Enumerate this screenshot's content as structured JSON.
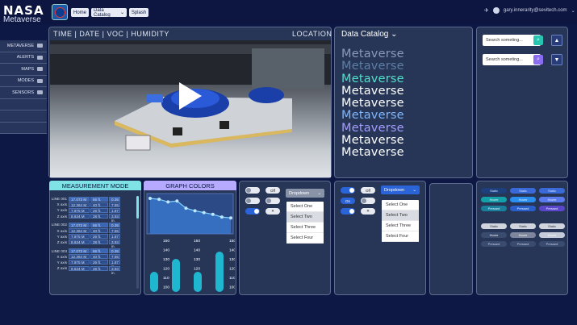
{
  "header": {
    "logo": "NASA",
    "app": "Metaverse",
    "nav": [
      "Home",
      "Data Catalog",
      "Splash"
    ],
    "user_email": "gary.innerarity@sevitech.com"
  },
  "sidebar": {
    "items": [
      "METAVERSE",
      "ALERTS",
      "MAPS",
      "MODES",
      "SENSORS",
      "",
      "",
      ""
    ]
  },
  "video": {
    "labels": "TIME  |  DATE  |  VOC  |  HUMIDITY",
    "location": "LOCATION"
  },
  "catalog": {
    "title": "Data Catalog",
    "items": [
      "Metaverse",
      "Metaverse",
      "Metaverse",
      "Metaverse",
      "Metaverse",
      "Metaverse",
      "Metaverse",
      "Metaverse",
      "Metaverse"
    ],
    "colors": [
      "#8c98b8",
      "#5c7fa5",
      "#4fe0c8",
      "#ffffff",
      "#ffffff",
      "#7eb6ff",
      "#a59bff",
      "#ffffff",
      "#ffffff"
    ]
  },
  "search": {
    "placeholder": "Search someting...",
    "rows": [
      {
        "btn_color": "#27c4b0",
        "arrow": "▲"
      },
      {
        "btn_color": "#8a6cf0",
        "arrow": "▼"
      }
    ]
  },
  "measurement": {
    "title": "MEASUREMENT MODE",
    "groups": [
      {
        "line": "LINE 001",
        "rows": [
          [
            "",
            "17.073 M",
            "56 ft.",
            "0.36 in."
          ],
          [
            "X axis",
            "12.364 M",
            "40 ft.",
            "7.55 in."
          ],
          [
            "Y axis",
            "7.975 M",
            "26 ft.",
            "1.87 in."
          ],
          [
            "Z axis",
            "8.634 M",
            "28 ft.",
            "3.93 in."
          ]
        ]
      },
      {
        "line": "LINE 002",
        "rows": [
          [
            "",
            "17.073 M",
            "56 ft.",
            "0.36 in."
          ],
          [
            "X axis",
            "12.364 M",
            "40 ft.",
            "7.55 in."
          ],
          [
            "Y axis",
            "7.975 M",
            "26 ft.",
            "1.87 in."
          ],
          [
            "Z axis",
            "8.634 M",
            "28 ft.",
            "3.93 in."
          ]
        ]
      },
      {
        "line": "LINE 003",
        "rows": [
          [
            "",
            "17.073 M",
            "56 ft.",
            "0.36 in."
          ],
          [
            "X axis",
            "12.364 M",
            "40 ft.",
            "7.55 in."
          ],
          [
            "Y axis",
            "7.975 M",
            "26 ft.",
            "1.87 in."
          ],
          [
            "Z axis",
            "8.634 M",
            "28 ft.",
            "3.93 in."
          ]
        ]
      }
    ]
  },
  "graph": {
    "title": "GRAPH COLORS",
    "ticks": [
      "150",
      "140",
      "130",
      "120",
      "110",
      "100"
    ],
    "line_points": [
      80,
      78,
      72,
      74,
      58,
      52,
      48,
      44,
      38,
      36
    ],
    "bars": [
      120,
      136,
      120,
      145
    ]
  },
  "controls1": {
    "off": "Off",
    "on": "On",
    "dropdown": "Dropdown",
    "options": [
      "Select One",
      "Select Two",
      "Select Three",
      "Select Four"
    ],
    "selected": 1
  },
  "controls2": {
    "off": "Off",
    "on": "On",
    "dropdown": "Dropdown",
    "options": [
      "Select One",
      "Select Two",
      "Select Three",
      "Select Four"
    ],
    "selected": 1
  },
  "states": {
    "row_labels": [
      "Static",
      "Hover",
      "Pressed"
    ]
  }
}
